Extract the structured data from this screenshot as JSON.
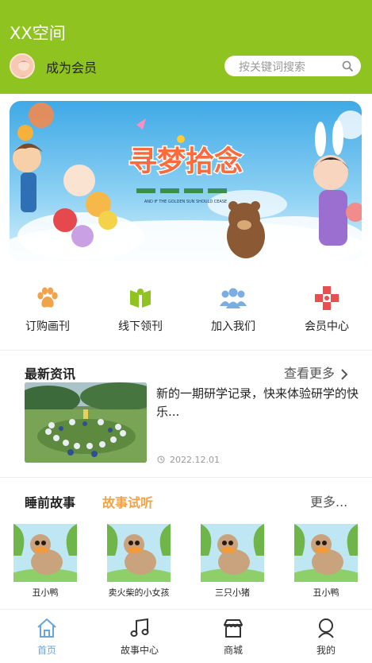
{
  "header": {
    "title": "XX空间",
    "member_label": "成为会员",
    "search_placeholder": "按关键词搜索",
    "bg_color": "#8fc31f"
  },
  "banner": {
    "headline": "寻梦拾念",
    "caption": "AND IF THE GOLDEN SUN SHOULD CEASE"
  },
  "grid_nav": [
    {
      "label": "订购画刊",
      "icon": "paw-icon",
      "color": "#f0a34b"
    },
    {
      "label": "线下领刊",
      "icon": "book-icon",
      "color": "#8fc31f"
    },
    {
      "label": "加入我们",
      "icon": "people-icon",
      "color": "#7aaee0"
    },
    {
      "label": "会员中心",
      "icon": "gamepad-cross-icon",
      "color": "#e94f4f"
    }
  ],
  "news": {
    "title": "最新资讯",
    "more": "查看更多",
    "item": {
      "text": "新的一期研学记录，快来体验研学的快乐...",
      "date": "2022.12.01"
    }
  },
  "stories": {
    "title": "睡前故事",
    "tab": "故事试听",
    "more": "更多...",
    "items": [
      {
        "name": "丑小鸭"
      },
      {
        "name": "卖火柴的小女孩"
      },
      {
        "name": "三只小猪"
      },
      {
        "name": "丑小鸭"
      }
    ]
  },
  "tabbar": [
    {
      "label": "首页",
      "icon": "home-icon",
      "active": true
    },
    {
      "label": "故事中心",
      "icon": "music-note-icon",
      "active": false
    },
    {
      "label": "商城",
      "icon": "shop-icon",
      "active": false
    },
    {
      "label": "我的",
      "icon": "user-icon",
      "active": false
    }
  ]
}
